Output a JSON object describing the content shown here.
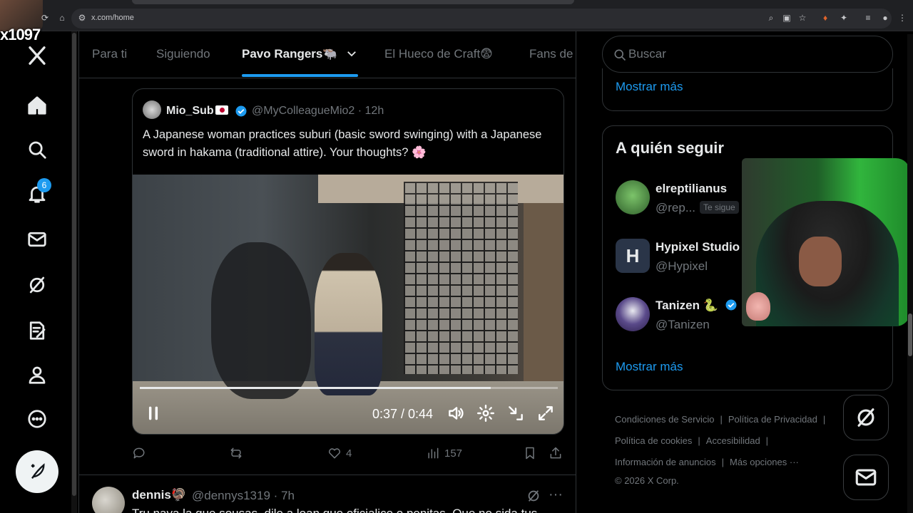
{
  "browser": {
    "url": "x.com/home",
    "watermark": "x1097"
  },
  "nav": {
    "notification_count": "6"
  },
  "tabs": [
    {
      "label": "Para ti"
    },
    {
      "label": "Siguiendo"
    },
    {
      "label": "Pavo Rangers🐃"
    },
    {
      "label": "El Hueco de Craft😨"
    },
    {
      "label": "Fans de"
    }
  ],
  "quoted_post": {
    "author": "Mio_Sub",
    "handle": "@MyColleagueMio2 · 12h",
    "text": "A Japanese woman practices suburi (basic sword swinging) with a Japanese sword in hakama (traditional attire). Your thoughts? 🌸",
    "video_time": "0:37 / 0:44",
    "video_progress": 0.84
  },
  "post_actions": {
    "likes": "4",
    "views": "157"
  },
  "next_post": {
    "author": "dennis🦃",
    "handle": "@dennys1319 · 7h",
    "text_partial": "Tru nava la que sousas, dile a loan que oficialice o penitas. Que no sida tus"
  },
  "sidebar": {
    "search_placeholder": "Buscar",
    "show_more_1": "Mostrar más",
    "who_to_follow_title": "A quién seguir",
    "who_to_follow": [
      {
        "name": "elreptilianus",
        "handle": "@rep...",
        "follows_you": "Te sigue"
      },
      {
        "name": "Hypixel Studio",
        "handle": "@Hypixel"
      },
      {
        "name": "Tanizen 🐍",
        "handle": "@Tanizen"
      }
    ],
    "show_more_2": "Mostrar más",
    "footer": {
      "terms": "Condiciones de Servicio",
      "privacy": "Política de Privacidad",
      "cookies": "Política de cookies",
      "accessibility": "Accesibilidad",
      "ads_info": "Información de anuncios",
      "more": "Más opciones ···",
      "copyright": "© 2026 X Corp."
    }
  },
  "colors": {
    "accent": "#1d9bf0",
    "background": "#000000",
    "muted_text": "#71767b",
    "border": "#2f3336"
  }
}
